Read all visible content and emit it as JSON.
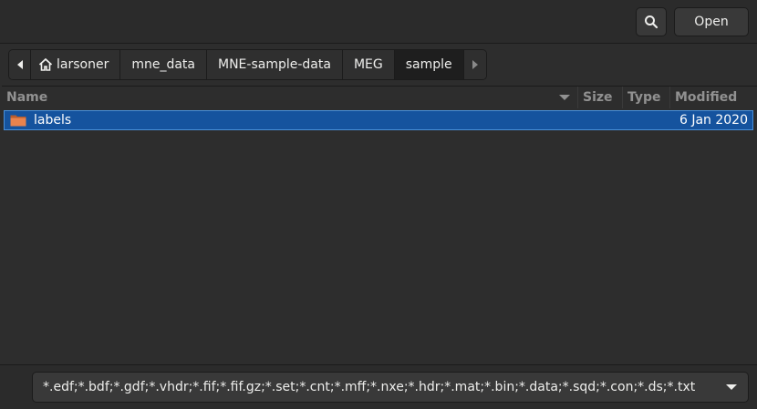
{
  "header": {
    "search_icon": "search-icon",
    "open_label": "Open"
  },
  "pathbar": {
    "back_icon": "chevron-left-icon",
    "forward_icon": "chevron-right-icon",
    "home_icon": "home-icon",
    "segments": [
      "larsoner",
      "mne_data",
      "MNE-sample-data",
      "MEG",
      "sample"
    ],
    "active_segment": "sample"
  },
  "columns": {
    "name": "Name",
    "size": "Size",
    "type": "Type",
    "modified": "Modified"
  },
  "files": [
    {
      "name": "labels",
      "icon": "folder-icon",
      "modified": "6 Jan 2020",
      "selected": true
    }
  ],
  "filter": {
    "value": "*.edf;*.bdf;*.gdf;*.vhdr;*.fif;*.fif.gz;*.set;*.cnt;*.mff;*.nxe;*.hdr;*.mat;*.bin;*.data;*.sqd;*.con;*.ds;*.txt"
  },
  "colors": {
    "selection": "#15539e",
    "background": "#2d2d2d",
    "folder": "#e8834e"
  }
}
